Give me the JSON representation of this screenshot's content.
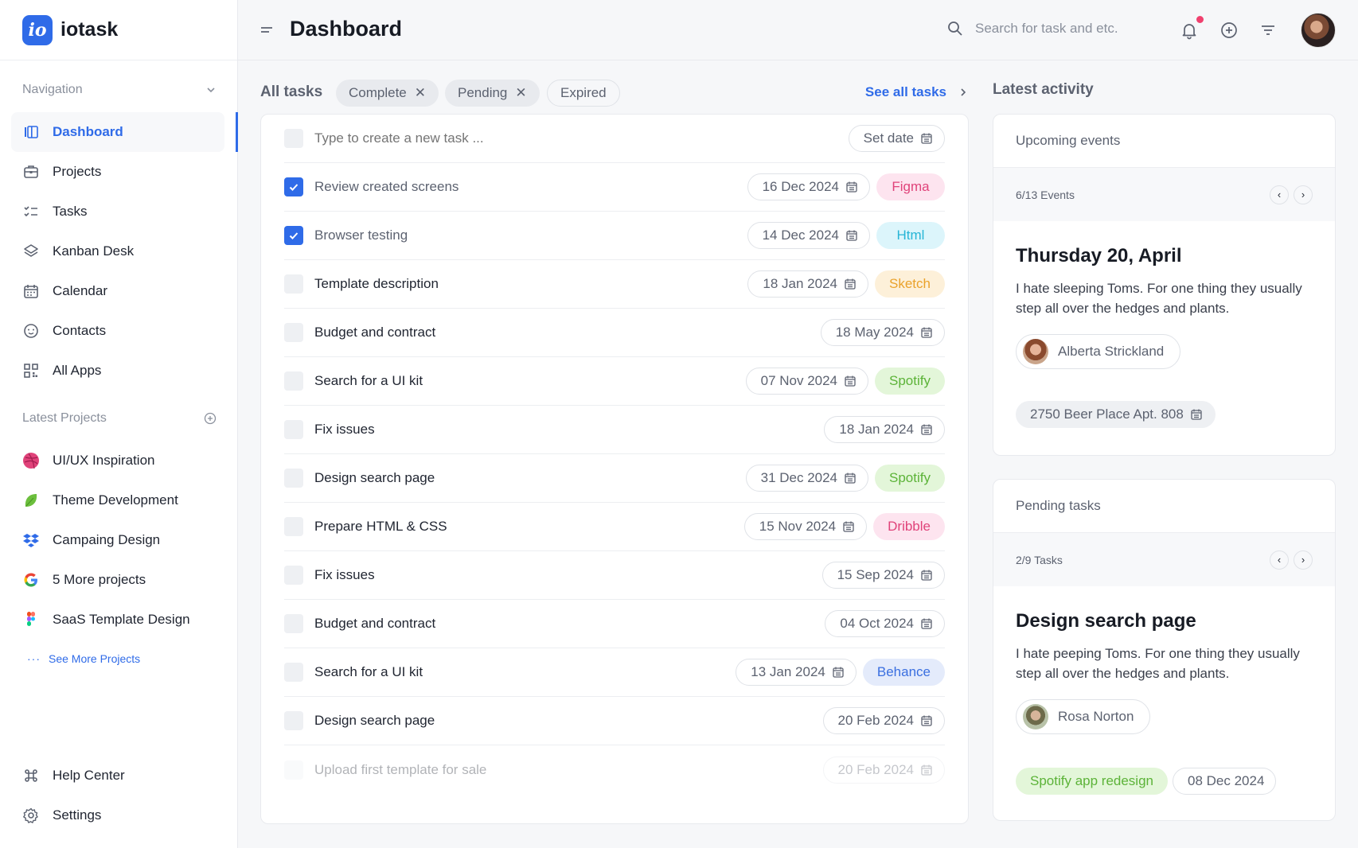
{
  "brand": {
    "logo_text": "io",
    "name": "iotask"
  },
  "sidebar": {
    "nav_heading": "Navigation",
    "nav_items": [
      {
        "label": "Dashboard",
        "icon": "dashboard-icon",
        "active": true
      },
      {
        "label": "Projects",
        "icon": "briefcase-icon"
      },
      {
        "label": "Tasks",
        "icon": "checklist-icon"
      },
      {
        "label": "Kanban Desk",
        "icon": "layers-icon"
      },
      {
        "label": "Calendar",
        "icon": "calendar-icon"
      },
      {
        "label": "Contacts",
        "icon": "smile-icon"
      },
      {
        "label": "All Apps",
        "icon": "grid-icon"
      }
    ],
    "projects_heading": "Latest Projects",
    "projects": [
      {
        "label": "UI/UX Inspiration",
        "icon": "dribbble-icon",
        "color": "#e0437a"
      },
      {
        "label": "Theme Development",
        "icon": "leaf-icon",
        "color": "#6cbf3d"
      },
      {
        "label": "Campaing Design",
        "icon": "dropbox-icon",
        "color": "#2f6be8"
      },
      {
        "label": "5 More projects",
        "icon": "google-icon",
        "color": "#4285f4"
      },
      {
        "label": "SaaS Template Design",
        "icon": "figma-icon",
        "color": "#f24e1e"
      }
    ],
    "see_more": "See More Projects",
    "see_more_dots": "···",
    "bottom_items": [
      {
        "label": "Help Center",
        "icon": "command-icon"
      },
      {
        "label": "Settings",
        "icon": "gear-icon"
      }
    ]
  },
  "topbar": {
    "title": "Dashboard",
    "search_placeholder": "Search for task and etc."
  },
  "tasks": {
    "title": "All tasks",
    "filters": [
      {
        "label": "Complete",
        "removable": true
      },
      {
        "label": "Pending",
        "removable": true
      },
      {
        "label": "Expired",
        "removable": false
      }
    ],
    "filter_remove_glyph": "✕",
    "see_all": "See all tasks",
    "new_task_placeholder": "Type to create a new task ...",
    "set_date": "Set date",
    "rows": [
      {
        "name": "Review created screens",
        "date": "16 Dec 2024",
        "done": true,
        "tag": "Figma",
        "tag_bg": "#fde4ef",
        "tag_fg": "#e0437a"
      },
      {
        "name": "Browser testing",
        "date": "14 Dec 2024",
        "done": true,
        "tag": "Html",
        "tag_bg": "#dcf5fb",
        "tag_fg": "#27b5d6"
      },
      {
        "name": "Template description",
        "date": "18 Jan 2024",
        "done": false,
        "tag": "Sketch",
        "tag_bg": "#fdf0d9",
        "tag_fg": "#eaa22b"
      },
      {
        "name": "Budget and contract",
        "date": "18 May 2024",
        "done": false,
        "tag": ""
      },
      {
        "name": "Search for a UI kit",
        "date": "07 Nov 2024",
        "done": false,
        "tag": "Spotify",
        "tag_bg": "#e3f6d9",
        "tag_fg": "#5cb338"
      },
      {
        "name": "Fix issues",
        "date": "18 Jan 2024",
        "done": false,
        "tag": ""
      },
      {
        "name": "Design search page",
        "date": "31 Dec 2024",
        "done": false,
        "tag": "Spotify",
        "tag_bg": "#e3f6d9",
        "tag_fg": "#5cb338"
      },
      {
        "name": "Prepare HTML & CSS",
        "date": "15 Nov 2024",
        "done": false,
        "tag": "Dribble",
        "tag_bg": "#fde4ef",
        "tag_fg": "#e0437a"
      },
      {
        "name": "Fix issues",
        "date": "15 Sep 2024",
        "done": false,
        "tag": ""
      },
      {
        "name": "Budget and contract",
        "date": "04 Oct 2024",
        "done": false,
        "tag": ""
      },
      {
        "name": "Search for a UI kit",
        "date": "13 Jan 2024",
        "done": false,
        "tag": "Behance",
        "tag_bg": "#e4ebfb",
        "tag_fg": "#3a6fe0"
      },
      {
        "name": "Design search page",
        "date": "20 Feb 2024",
        "done": false,
        "tag": ""
      },
      {
        "name": "Upload first template for sale",
        "date": "20 Feb 2024",
        "done": false,
        "tag": "",
        "faded": true
      }
    ]
  },
  "activity": {
    "title": "Latest activity",
    "upcoming": {
      "heading": "Upcoming events",
      "counter": "6/13 Events",
      "event_title": "Thursday 20, April",
      "text": "I hate sleeping Toms. For one thing they usually step all over the hedges and plants.",
      "person": "Alberta Strickland",
      "address": "2750 Beer Place Apt. 808"
    },
    "pending": {
      "heading": "Pending tasks",
      "counter": "2/9 Tasks",
      "task_title": "Design search page",
      "text": "I hate peeping Toms. For one thing they usually step all over the hedges and plants.",
      "person": "Rosa Norton",
      "tag": "Spotify app redesign",
      "date": "08 Dec 2024"
    },
    "pager_prev": "‹",
    "pager_next": "›"
  },
  "colors": {
    "accent": "#2f6be8",
    "notification": "#f0406e"
  }
}
